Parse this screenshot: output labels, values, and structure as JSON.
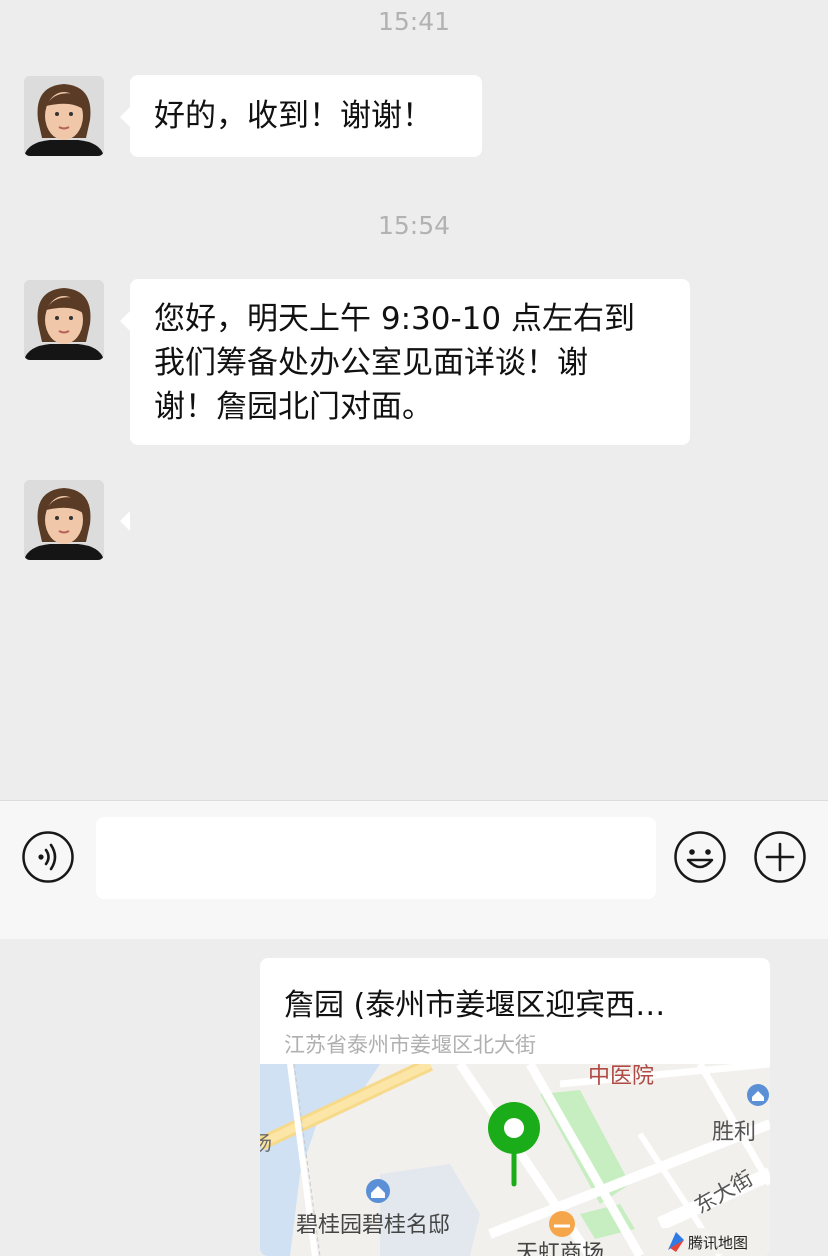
{
  "chat": {
    "messages": [
      {
        "time": "15:41",
        "text": "好的，收到！谢谢！"
      },
      {
        "time": "15:54",
        "lines": [
          "您好，明天上午 9:30-10 点左右到",
          "我们筹备处办公室见面详谈！谢",
          "谢！詹园北门对面。"
        ]
      }
    ],
    "location": {
      "title": "詹园 (泰州市姜堰区迎宾西…",
      "address": "江苏省泰州市姜堰区北大街",
      "map_labels": {
        "hospital": "中医院",
        "street_shengli": "胜利",
        "street_dongda": "东大街",
        "estate": "碧桂园碧桂名邸",
        "bottom": "天虹商场",
        "left_edge": "汤",
        "provider": "腾讯地图"
      }
    }
  },
  "toolbar": {
    "input_value": "",
    "voice_icon": "voice-icon",
    "emoji_icon": "emoji-icon",
    "plus_icon": "plus-icon"
  },
  "colors": {
    "background": "#ededed",
    "bubble": "#ffffff",
    "pin": "#1aad19",
    "park": "#c6eec0"
  }
}
